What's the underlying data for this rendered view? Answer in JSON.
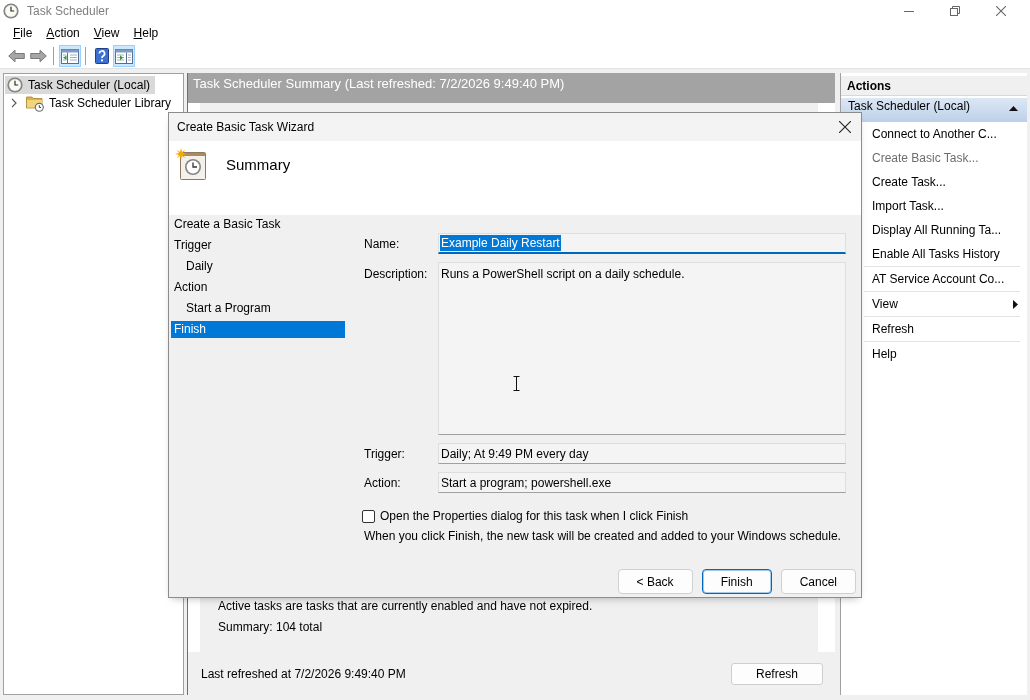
{
  "window": {
    "title": "Task Scheduler"
  },
  "menu_bar": [
    "File",
    "Action",
    "View",
    "Help"
  ],
  "toolbar": {
    "groups": [
      [
        {
          "kind": "back",
          "on": false
        },
        {
          "kind": "forward",
          "on": false
        }
      ],
      [
        {
          "kind": "console-tree",
          "on": true
        }
      ],
      [
        {
          "kind": "help",
          "on": false
        },
        {
          "kind": "action-pane",
          "on": true
        }
      ]
    ]
  },
  "navigation_tree": {
    "items": [
      {
        "kind": "scheduler",
        "label": "Task Scheduler (Local)",
        "selected": true,
        "children": [
          {
            "kind": "library",
            "label": "Task Scheduler Library",
            "selected": false,
            "expanded": false
          }
        ]
      }
    ]
  },
  "summary_pane": {
    "title": "Task Scheduler Summary (Last refreshed: 7/2/2026 9:49:40 PM)",
    "lines": [
      "Active tasks are tasks that are currently enabled and have not expired.",
      "Summary: 104 total"
    ],
    "last_refreshed": "Last refreshed at 7/2/2026 9:49:40 PM",
    "refresh_button": "Refresh"
  },
  "actions_pane": {
    "title": "Actions",
    "section": {
      "label": "Task Scheduler (Local)",
      "expanded": true
    },
    "groups": [
      [
        {
          "label": "Connect to Another C...",
          "kind": "command",
          "disabled": false
        },
        {
          "label": "Create Basic Task...",
          "kind": "command",
          "disabled": true
        },
        {
          "label": "Create Task...",
          "kind": "command",
          "disabled": false
        },
        {
          "label": "Import Task...",
          "kind": "command",
          "disabled": false
        },
        {
          "label": "Display All Running Ta...",
          "kind": "command",
          "disabled": false
        },
        {
          "label": "Enable All Tasks History",
          "kind": "command",
          "disabled": false
        }
      ],
      [
        {
          "label": "AT Service Account Co...",
          "kind": "command",
          "disabled": false
        }
      ],
      [
        {
          "label": "View",
          "kind": "submenu",
          "disabled": false
        }
      ],
      [
        {
          "label": "Refresh",
          "kind": "command",
          "disabled": false
        }
      ],
      [
        {
          "label": "Help",
          "kind": "command",
          "disabled": false
        }
      ]
    ]
  },
  "dialog": {
    "title": "Create Basic Task Wizard",
    "heading": "Summary",
    "steps": [
      {
        "label": "Create a Basic Task",
        "selected": false
      },
      {
        "label": "Trigger",
        "selected": false,
        "children": [
          {
            "label": "Daily",
            "selected": false
          }
        ]
      },
      {
        "label": "Action",
        "selected": false,
        "children": [
          {
            "label": "Start a Program",
            "selected": false
          }
        ]
      },
      {
        "label": "Finish",
        "selected": true
      }
    ],
    "fields": [
      {
        "kind": "text",
        "label": "Name:",
        "value": "Example Daily Restart",
        "focused": true,
        "text_selected": true
      },
      {
        "kind": "multiline",
        "label": "Description:",
        "value": "Runs a PowerShell script on a daily schedule.",
        "focused": false,
        "text_selected": false
      },
      {
        "kind": "readonly",
        "label": "Trigger:",
        "value": "Daily; At 9:49 PM every day",
        "focused": false,
        "text_selected": false
      },
      {
        "kind": "readonly",
        "label": "Action:",
        "value": "Start a program; powershell.exe",
        "focused": false,
        "text_selected": false
      }
    ],
    "open_properties": {
      "label": "Open the Properties dialog for this task when I click Finish",
      "checked": false
    },
    "note": "When you click Finish, the new task will be created and added to your Windows schedule.",
    "buttons": [
      {
        "label": "< Back",
        "default": false
      },
      {
        "label": "Finish",
        "default": true
      },
      {
        "label": "Cancel",
        "default": false
      }
    ]
  }
}
